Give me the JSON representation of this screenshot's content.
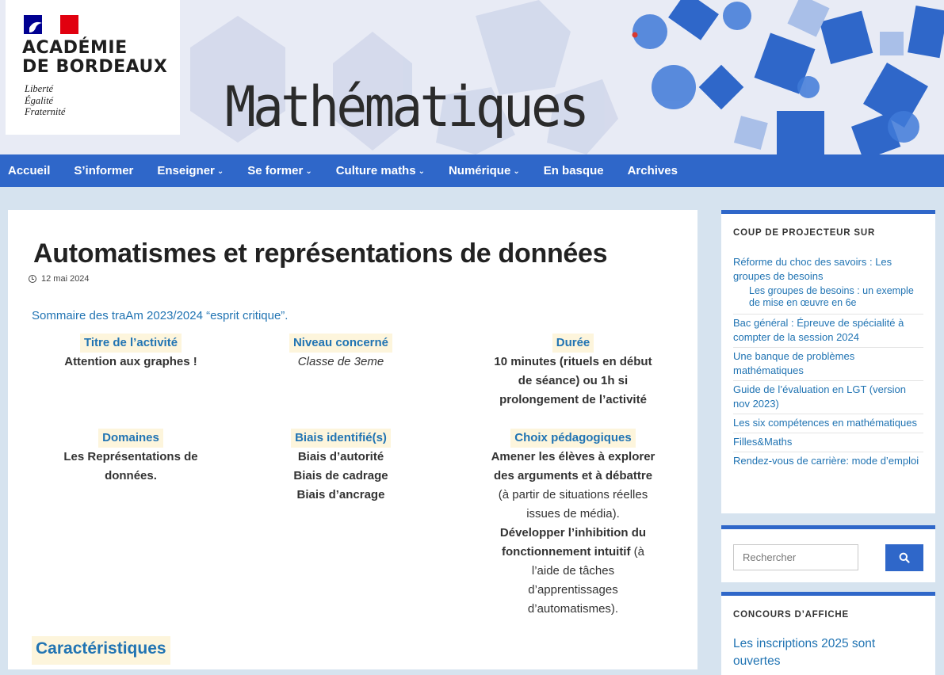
{
  "header": {
    "logo_lines": "ACADÉMIE\nDE BORDEAUX",
    "motto": "Liberté\nÉgalité\nFraternité",
    "site_title": "Mathématiques"
  },
  "nav": {
    "items": [
      {
        "label": "Accueil",
        "has_dropdown": false
      },
      {
        "label": "S’informer",
        "has_dropdown": false
      },
      {
        "label": "Enseigner",
        "has_dropdown": true
      },
      {
        "label": "Se former",
        "has_dropdown": true
      },
      {
        "label": "Culture maths",
        "has_dropdown": true
      },
      {
        "label": "Numérique",
        "has_dropdown": true
      },
      {
        "label": "En basque",
        "has_dropdown": false
      },
      {
        "label": "Archives",
        "has_dropdown": false
      }
    ]
  },
  "article": {
    "title": "Automatismes et représentations de données",
    "date": "12 mai 2024",
    "sommaire_link": "Sommaire des traAm 2023/2024 “esprit critique”.",
    "columns": [
      {
        "heading": "Titre de l’activité",
        "lines": [
          "Attention aux graphes !"
        ]
      },
      {
        "heading": "Niveau concerné",
        "lines": [
          "Classe de 3eme"
        ]
      },
      {
        "heading": "Durée",
        "lines": [
          "10 minutes (rituels en début",
          "de séance) ou 1h si",
          "prolongement de l’activité"
        ]
      },
      {
        "heading": "Domaines",
        "lines": [
          "Les Représentations de",
          "données."
        ]
      },
      {
        "heading": "Biais identifié(s)",
        "lines": [
          "Biais d’autorité",
          "Biais de cadrage",
          "Biais d’ancrage"
        ]
      },
      {
        "heading": "Choix pédagogiques",
        "lines": [
          "Amener les élèves à explorer",
          "des arguments et à débattre",
          "(à partir de situations réelles",
          "issues de média).",
          "Développer l’inhibition du",
          "fonctionnement intuitif",
          "(à",
          "l’aide de tâches",
          "d’apprentissages",
          "d’automatismes)."
        ]
      }
    ],
    "caracteristiques_heading": "Caractéristiques"
  },
  "sidebar": {
    "spotlight": {
      "title": "COUP DE PROJECTEUR SUR",
      "items": [
        "Réforme du choc des savoirs : Les groupes de besoins",
        "Les groupes de besoins : un exemple de mise en œuvre en 6e",
        "Bac général : Épreuve de spécialité à compter de la session 2024",
        "Une banque de problèmes mathématiques",
        "Guide de l’évaluation en LGT (version nov 2023)",
        "Les six compétences en mathématiques",
        "Filles&Maths",
        "Rendez-vous de carrière: mode d’emploi"
      ]
    },
    "search": {
      "placeholder": "Rechercher"
    },
    "concours": {
      "title": "CONCOURS D’AFFICHE",
      "link": "Les inscriptions 2025 sont ouvertes"
    }
  },
  "colors": {
    "nav_blue": "#2f67c9",
    "link_blue": "#2174b3",
    "page_bg": "#d6e3ef",
    "heading_highlight": "#fdf5dc"
  }
}
